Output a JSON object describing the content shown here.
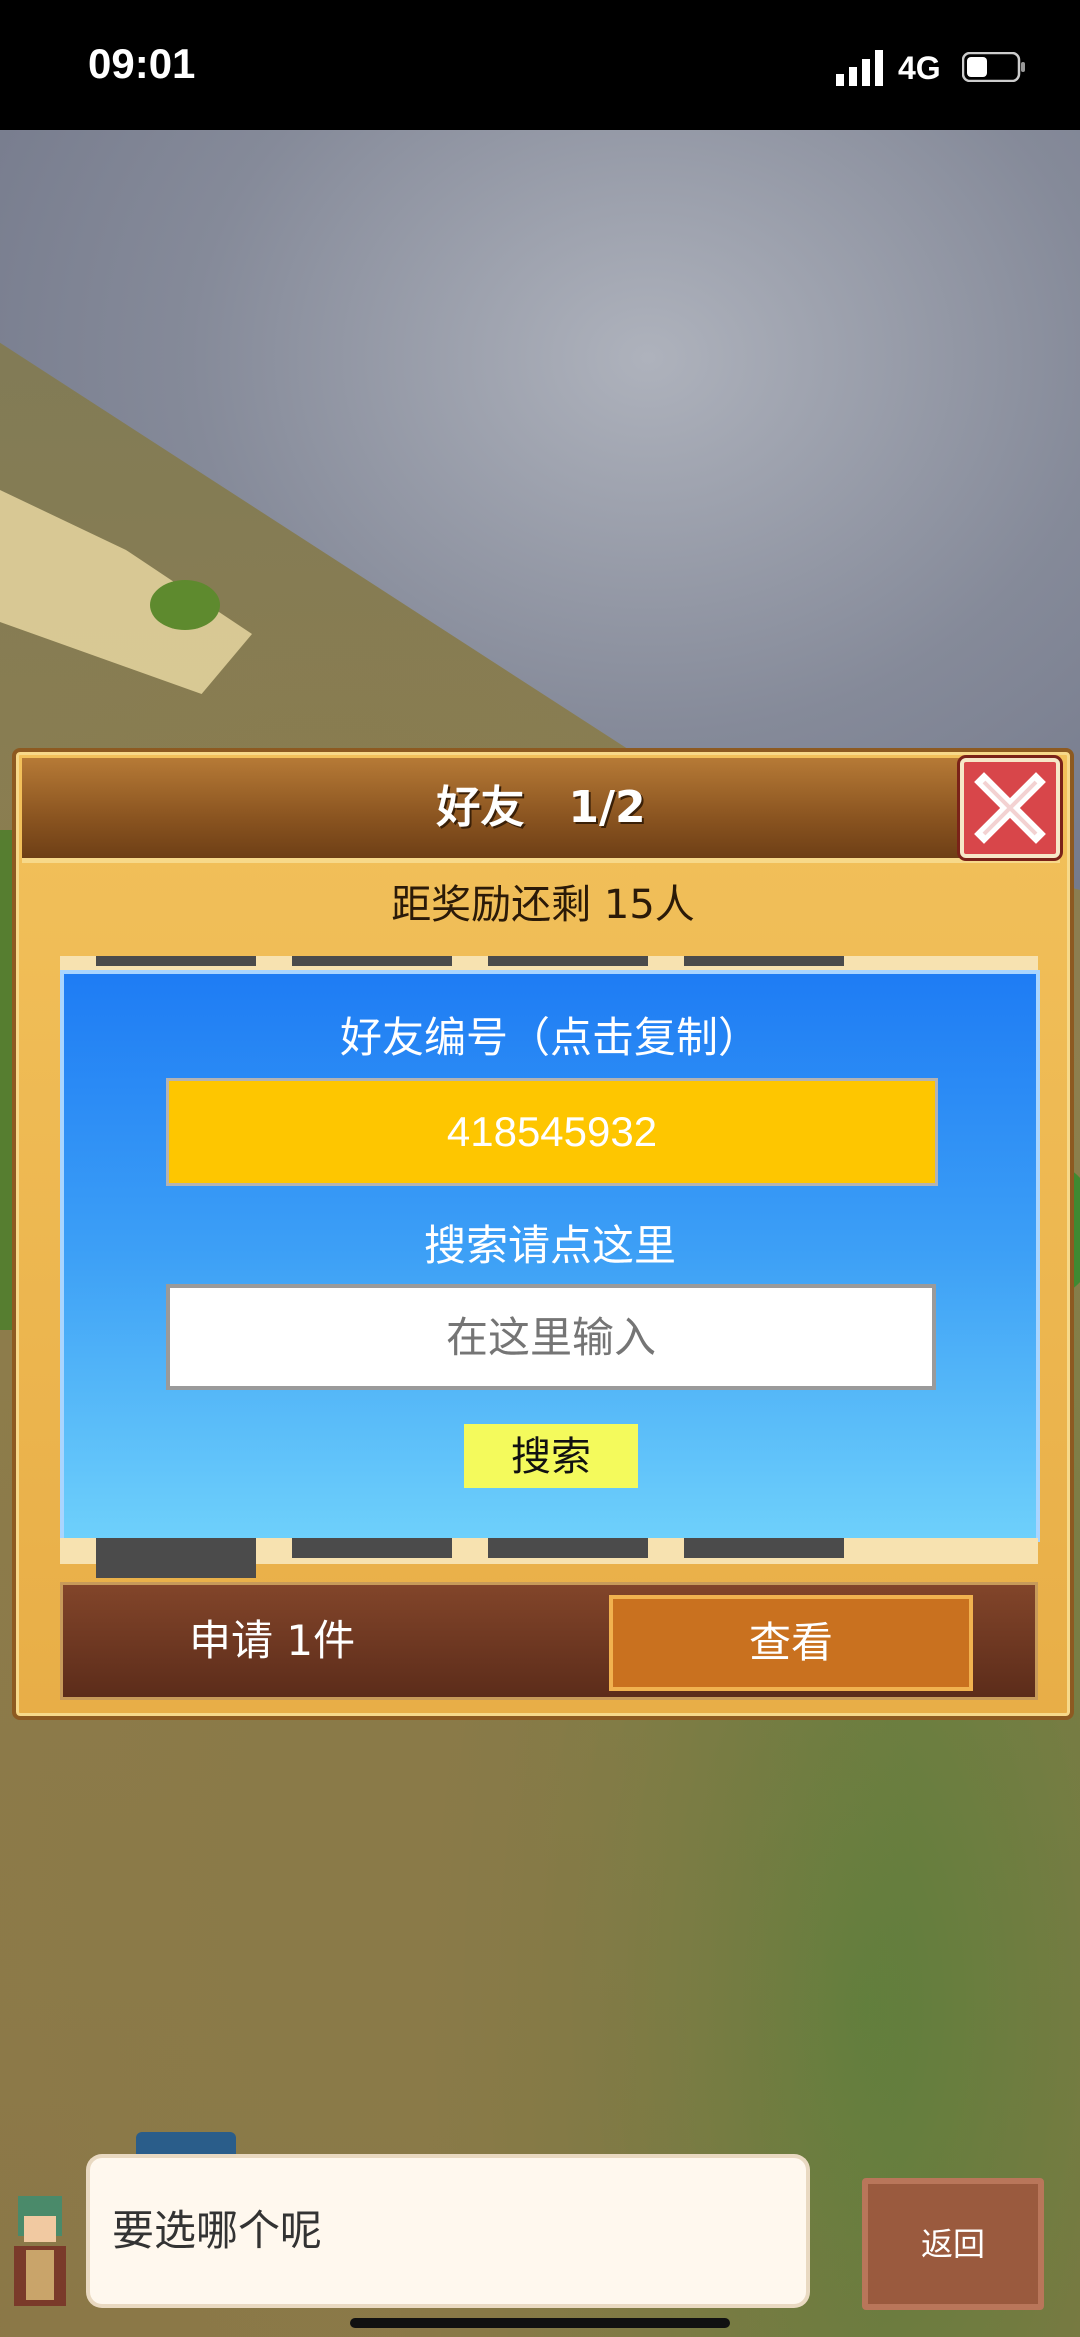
{
  "status_bar": {
    "time": "09:01",
    "network": "4G"
  },
  "dialog": {
    "title": "好友　1/2",
    "subtitle": "距奖励还剩 15人",
    "friend_id_label": "好友编号（点击复制）",
    "friend_id": "418545932",
    "search_label": "搜索请点这里",
    "search_placeholder": "在这里输入",
    "search_button": "搜索",
    "apply_text": "申请 1件",
    "view_button": "查看"
  },
  "bottom": {
    "message": "要选哪个呢",
    "back_button": "返回"
  },
  "colors": {
    "panel_blue": "#1e7cf4",
    "id_yellow": "#fec600",
    "close_red": "#d8464a",
    "view_orange": "#c9711f",
    "search_button": "#f4fa5c"
  }
}
